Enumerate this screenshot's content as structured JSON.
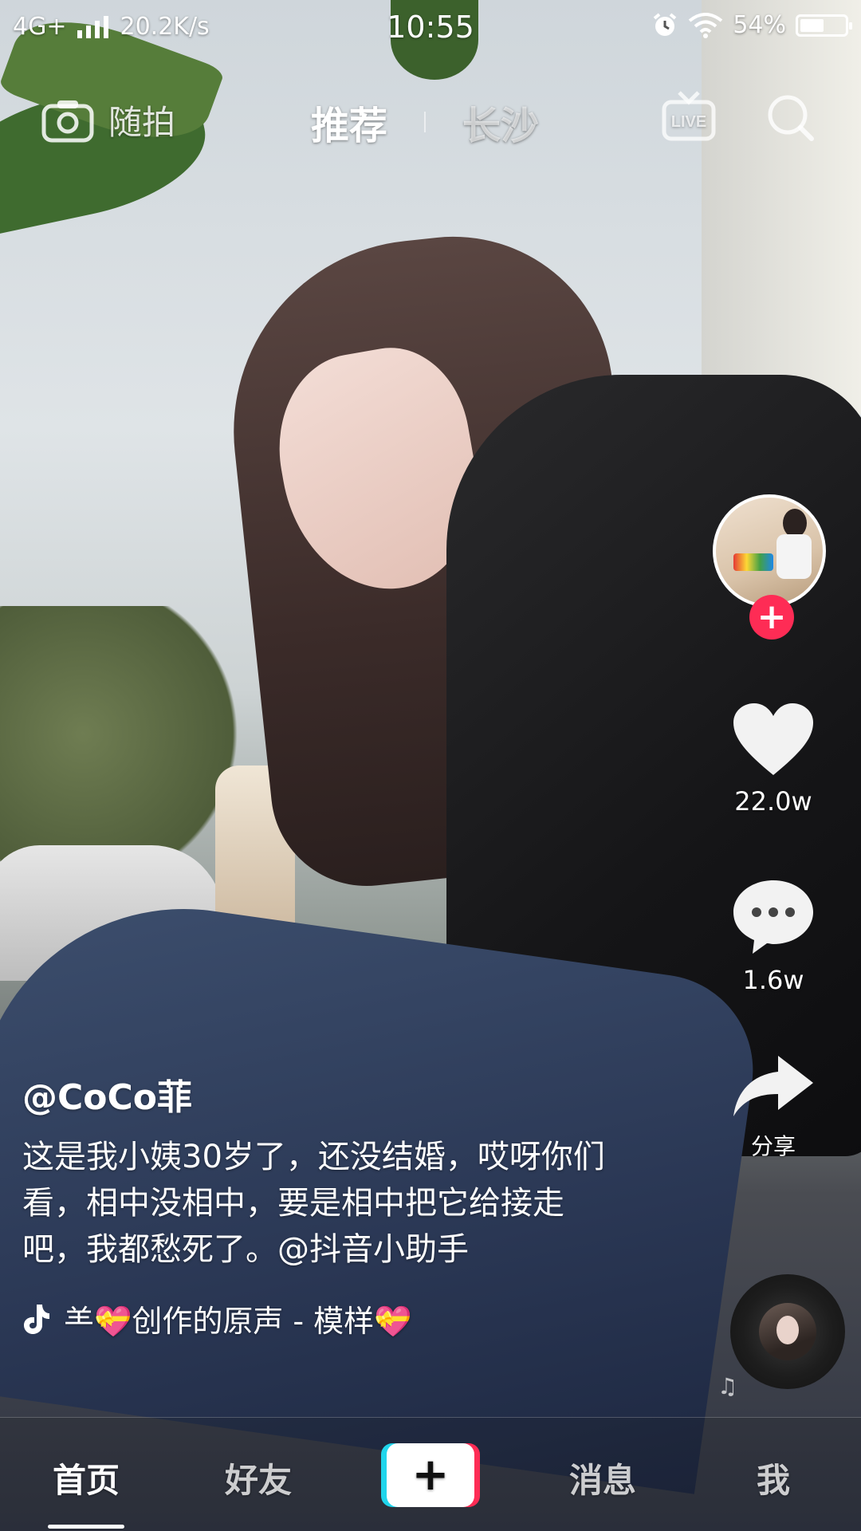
{
  "status_bar": {
    "network": "4G+",
    "speed": "20.2K/s",
    "time": "10:55",
    "battery_pct": "54%",
    "battery_level": 0.54
  },
  "top_nav": {
    "camera_label": "随拍",
    "tabs": [
      {
        "label": "推荐",
        "active": true
      },
      {
        "label": "长沙",
        "active": false
      }
    ],
    "live_label": "LIVE"
  },
  "actions": {
    "likes": "22.0w",
    "comments": "1.6w",
    "share": "分享",
    "follow": "+"
  },
  "caption": {
    "author": "@CoCo菲",
    "description": "这是我小姨30岁了，还没结婚，哎呀你们看，相中没相中，要是相中把它给接走吧，我都愁死了。@抖音小助手",
    "music": "⺷💝创作的原声 - 模样💝"
  },
  "bottom_nav": {
    "items": [
      {
        "label": "首页",
        "active": true
      },
      {
        "label": "好友",
        "active": false
      },
      {
        "label": "+",
        "active": false
      },
      {
        "label": "消息",
        "active": false
      },
      {
        "label": "我",
        "active": false
      }
    ]
  },
  "colors": {
    "accent_red": "#fe2c55",
    "accent_cyan": "#20d5ec",
    "text": "#ffffff"
  }
}
